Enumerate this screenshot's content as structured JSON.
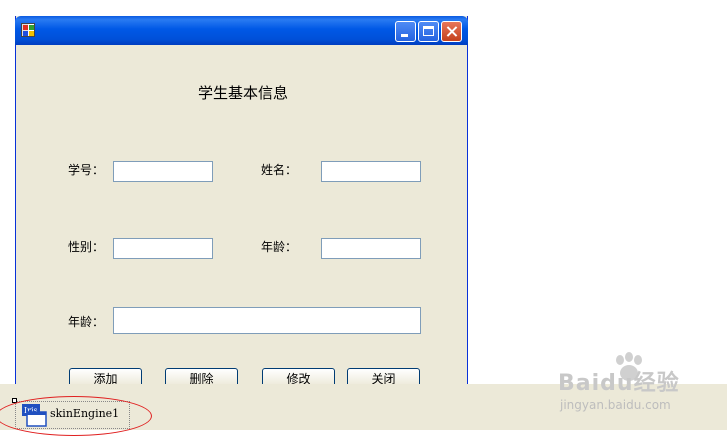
{
  "window": {
    "form_title": "学生基本信息"
  },
  "fields": {
    "student_id_label": "学号：",
    "name_label": "姓名：",
    "gender_label": "性别：",
    "age_label": "年龄：",
    "age2_label": "年龄：",
    "student_id_value": "",
    "name_value": "",
    "gender_value": "",
    "age_value": "",
    "age2_value": ""
  },
  "buttons": {
    "add": "添加",
    "delete": "删除",
    "modify": "修改",
    "close": "关闭"
  },
  "tray": {
    "component_label": "skinEngine1",
    "component_icon": "Iris"
  },
  "watermark": {
    "brand": "Baidu经验",
    "url": "jingyan.baidu.com"
  },
  "colors": {
    "titlebar": "#0058e6",
    "form_bg": "#ece9d8",
    "textbox_border": "#7f9db9",
    "highlight": "#e02020"
  }
}
